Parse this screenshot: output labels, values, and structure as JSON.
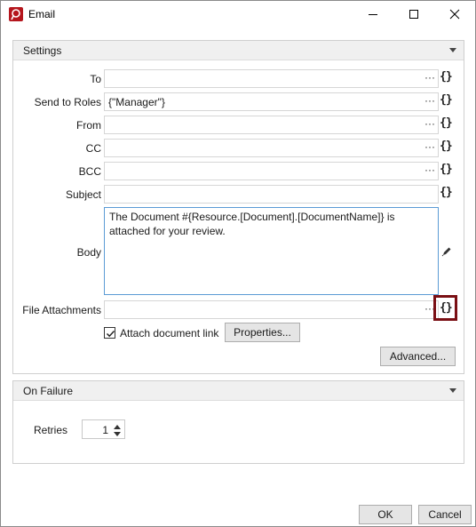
{
  "window": {
    "title": "Email"
  },
  "settings": {
    "title": "Settings",
    "fields": [
      {
        "label": "To",
        "value": ""
      },
      {
        "label": "Send to Roles",
        "value": "{\"Manager\"}"
      },
      {
        "label": "From",
        "value": ""
      },
      {
        "label": "CC",
        "value": ""
      },
      {
        "label": "BCC",
        "value": ""
      },
      {
        "label": "Subject",
        "value": ""
      }
    ],
    "body_label": "Body",
    "body_text": "The Document #{Resource.[Document].[DocumentName]} is attached for your review.",
    "attachments_label": "File Attachments",
    "attachments_value": "",
    "ellipsis": "···",
    "brace": "{}",
    "attach_link_label": "Attach document link",
    "attach_link_checked": true,
    "properties_button": "Properties...",
    "advanced_button": "Advanced..."
  },
  "on_failure": {
    "title": "On Failure",
    "retries_label": "Retries",
    "retries_value": "1"
  },
  "footer": {
    "ok": "OK",
    "cancel": "Cancel"
  },
  "colors": {
    "accent_border": "#7a0f14",
    "focus_border": "#5b9bd5",
    "app_icon": "#b5161d"
  }
}
